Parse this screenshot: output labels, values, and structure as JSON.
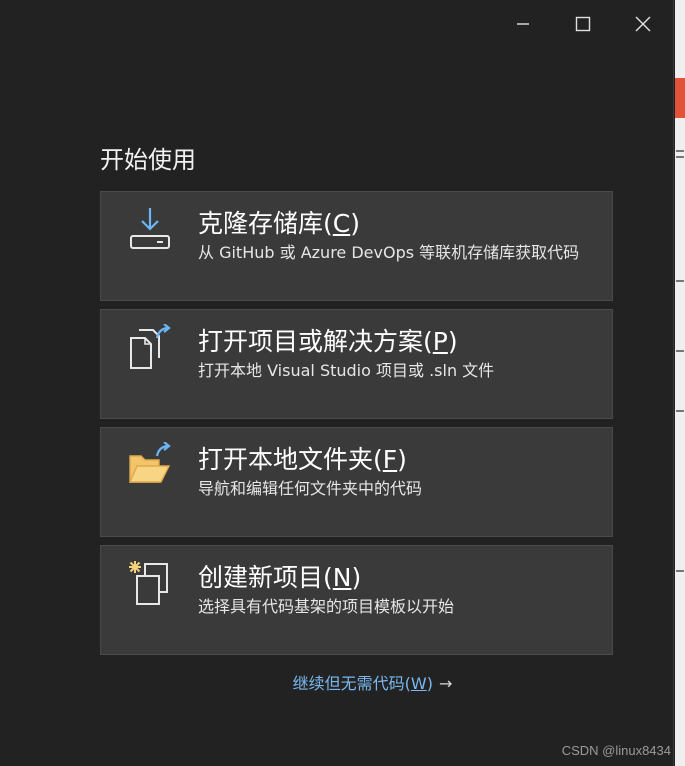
{
  "window_controls": {
    "minimize_icon": "minimize-icon",
    "maximize_icon": "maximize-icon",
    "close_icon": "close-icon"
  },
  "heading": "开始使用",
  "cards": [
    {
      "title": "克隆存储库(",
      "key": "C",
      "title_end": ")",
      "description": "从 GitHub 或 Azure DevOps 等联机存储库获取代码",
      "icon": "clone-repo-icon"
    },
    {
      "title": "打开项目或解决方案(",
      "key": "P",
      "title_end": ")",
      "description": "打开本地 Visual Studio 项目或 .sln 文件",
      "icon": "open-project-icon"
    },
    {
      "title": "打开本地文件夹(",
      "key": "F",
      "title_end": ")",
      "description": "导航和编辑任何文件夹中的代码",
      "icon": "open-folder-icon"
    },
    {
      "title": "创建新项目(",
      "key": "N",
      "title_end": ")",
      "description": "选择具有代码基架的项目模板以开始",
      "icon": "new-project-icon"
    }
  ],
  "continue_link": {
    "label": "继续但无需代码(",
    "key": "W",
    "label_end": ")",
    "arrow": "→"
  },
  "watermark": "CSDN @linux8434",
  "colors": {
    "accent_blue": "#6cb6f5",
    "folder_yellow": "#f2c56b",
    "link_blue": "#79b8f0",
    "card_bg": "#3a3a3a",
    "window_bg": "#222222"
  }
}
